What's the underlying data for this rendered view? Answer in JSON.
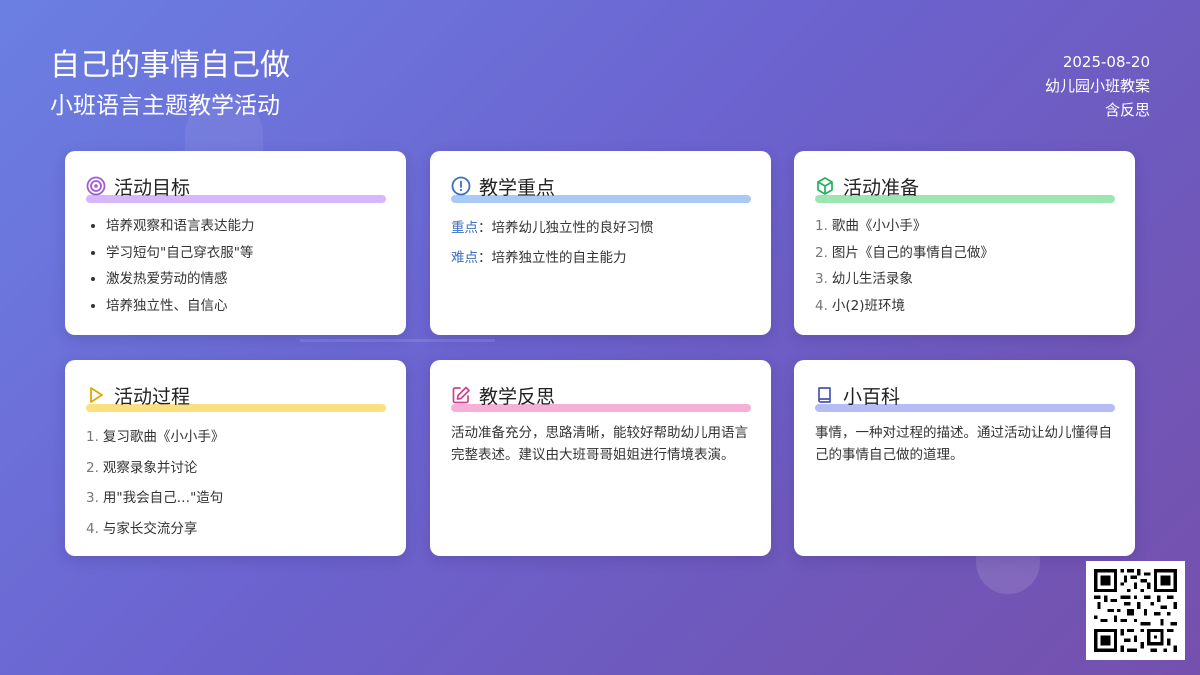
{
  "header": {
    "title": "自己的事情自己做",
    "subtitle": "小班语言主题教学活动",
    "date": "2025-08-20",
    "category": "幼儿园小班教案",
    "note": "含反思"
  },
  "cards": {
    "goals": {
      "title": "活动目标",
      "icon": "target-icon",
      "accent": "#d8b6fb",
      "items": [
        "培养观察和语言表达能力",
        "学习短句\"自己穿衣服\"等",
        "激发热爱劳动的情感",
        "培养独立性、自信心"
      ]
    },
    "focus": {
      "title": "教学重点",
      "icon": "alert-circle-icon",
      "accent": "#a9caf5",
      "key_label": "重点",
      "key_text": "：培养幼儿独立性的良好习惯",
      "difficulty_label": "难点",
      "difficulty_text": "：培养独立性的自主能力"
    },
    "prep": {
      "title": "活动准备",
      "icon": "cube-icon",
      "accent": "#9ce6b3",
      "items": [
        {
          "num": "1.",
          "text": "歌曲《小小手》"
        },
        {
          "num": "2.",
          "text": "图片《自己的事情自己做》"
        },
        {
          "num": "3.",
          "text": "幼儿生活录象"
        },
        {
          "num": "4.",
          "text": "小(2)班环境"
        }
      ]
    },
    "process": {
      "title": "活动过程",
      "icon": "play-icon",
      "accent": "#fbe07f",
      "items": [
        {
          "num": "1.",
          "text": "复习歌曲《小小手》"
        },
        {
          "num": "2.",
          "text": "观察录象并讨论"
        },
        {
          "num": "3.",
          "text": "用\"我会自己…\"造句"
        },
        {
          "num": "4.",
          "text": "与家长交流分享"
        }
      ]
    },
    "reflection": {
      "title": "教学反思",
      "icon": "edit-icon",
      "accent": "#f6b0d7",
      "text": "活动准备充分，思路清晰，能较好帮助幼儿用语言完整表述。建议由大班哥哥姐姐进行情境表演。"
    },
    "encyclopedia": {
      "title": "小百科",
      "icon": "book-icon",
      "accent": "#b5bdf4",
      "text": "事情，一种对过程的描述。通过活动让幼儿懂得自己的事情自己做的道理。"
    }
  },
  "qr_code": {
    "icon": "qr-code-icon"
  }
}
